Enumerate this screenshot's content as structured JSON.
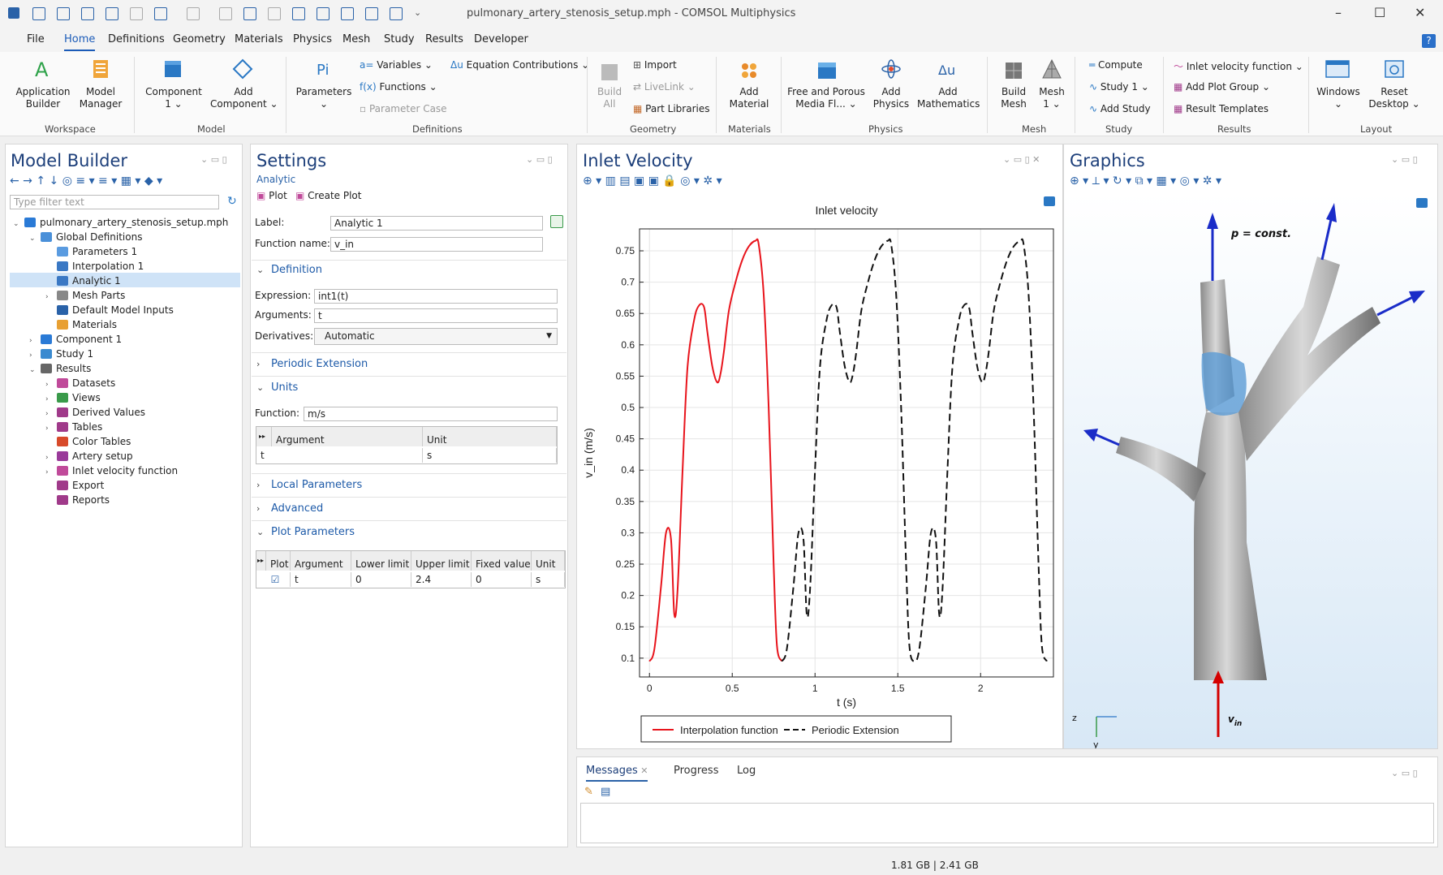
{
  "window": {
    "title": "pulmonary_artery_stenosis_setup.mph - COMSOL Multiphysics",
    "minimize": "–",
    "maximize": "☐",
    "close": "✕",
    "help": "?"
  },
  "menu": [
    "File",
    "Home",
    "Definitions",
    "Geometry",
    "Materials",
    "Physics",
    "Mesh",
    "Study",
    "Results",
    "Developer"
  ],
  "ribbon": {
    "application_builder": "Application\nBuilder",
    "model_manager": "Model\nManager",
    "component": "Component\n1 ⌄",
    "add_component": "Add\nComponent ⌄",
    "parameters": "Parameters\n⌄",
    "variables": "Variables ⌄",
    "functions": "Functions ⌄",
    "parameter_case": "Parameter Case",
    "equation_contributions": "Equation Contributions ⌄",
    "build_all": "Build\nAll",
    "import": "Import",
    "livelink": "LiveLink ⌄",
    "part_libraries": "Part Libraries",
    "add_material": "Add\nMaterial",
    "free_porous": "Free and Porous\nMedia Fl... ⌄",
    "add_physics": "Add\nPhysics",
    "add_mathematics": "Add\nMathematics",
    "build_mesh": "Build\nMesh",
    "mesh1": "Mesh\n1 ⌄",
    "compute": "Compute",
    "study1": "Study 1 ⌄",
    "add_study": "Add Study",
    "inlet_velocity_function": "Inlet velocity function ⌄",
    "add_plot_group": "Add Plot Group ⌄",
    "result_templates": "Result Templates",
    "windows": "Windows\n⌄",
    "reset_desktop": "Reset\nDesktop ⌄",
    "groups": [
      "Workspace",
      "Model",
      "Definitions",
      "Geometry",
      "Materials",
      "Physics",
      "Mesh",
      "Study",
      "Results",
      "Layout"
    ]
  },
  "model_builder": {
    "title": "Model Builder",
    "filter_placeholder": "Type filter text",
    "tree": [
      {
        "label": "pulmonary_artery_stenosis_setup.mph",
        "depth": 0,
        "arrow": "⌄",
        "color": "#2a7ad6"
      },
      {
        "label": "Global Definitions",
        "depth": 1,
        "arrow": "⌄",
        "color": "#4a90d9"
      },
      {
        "label": "Parameters 1",
        "depth": 2,
        "arrow": "",
        "color": "#5a9be0"
      },
      {
        "label": "Interpolation 1",
        "depth": 2,
        "arrow": "",
        "color": "#3a78c4"
      },
      {
        "label": "Analytic 1",
        "depth": 2,
        "arrow": "",
        "color": "#3a78c4"
      },
      {
        "label": "Mesh Parts",
        "depth": 2,
        "arrow": "›",
        "color": "#888"
      },
      {
        "label": "Default Model Inputs",
        "depth": 2,
        "arrow": "",
        "color": "#2a62a8"
      },
      {
        "label": "Materials",
        "depth": 2,
        "arrow": "",
        "color": "#e8a033"
      },
      {
        "label": "Component 1",
        "depth": 1,
        "arrow": "›",
        "color": "#2a7ad6"
      },
      {
        "label": "Study 1",
        "depth": 1,
        "arrow": "›",
        "color": "#3a8ad0"
      },
      {
        "label": "Results",
        "depth": 1,
        "arrow": "⌄",
        "color": "#666"
      },
      {
        "label": "Datasets",
        "depth": 2,
        "arrow": "›",
        "color": "#c04a9a"
      },
      {
        "label": "Views",
        "depth": 2,
        "arrow": "›",
        "color": "#3a9a4a"
      },
      {
        "label": "Derived Values",
        "depth": 2,
        "arrow": "›",
        "color": "#a03a8a"
      },
      {
        "label": "Tables",
        "depth": 2,
        "arrow": "›",
        "color": "#a03a8a"
      },
      {
        "label": "Color Tables",
        "depth": 2,
        "arrow": "",
        "color": "#d84a2a"
      },
      {
        "label": "Artery setup",
        "depth": 2,
        "arrow": "›",
        "color": "#9a3a9a"
      },
      {
        "label": "Inlet velocity function",
        "depth": 2,
        "arrow": "›",
        "color": "#c04a9a"
      },
      {
        "label": "Export",
        "depth": 2,
        "arrow": "",
        "color": "#a03a8a"
      },
      {
        "label": "Reports",
        "depth": 2,
        "arrow": "",
        "color": "#a03a8a"
      }
    ]
  },
  "settings": {
    "title": "Settings",
    "subtitle": "Analytic",
    "plot": "Plot",
    "create_plot": "Create Plot",
    "label_caption": "Label:",
    "label_value": "Analytic 1",
    "function_name_caption": "Function name:",
    "function_name_value": "v_in",
    "definition": "Definition",
    "expression_caption": "Expression:",
    "expression_value": "int1(t)",
    "arguments_caption": "Arguments:",
    "arguments_value": "t",
    "derivatives_caption": "Derivatives:",
    "derivatives_value": "Automatic",
    "periodic_extension": "Periodic Extension",
    "units": "Units",
    "function_caption": "Function:",
    "function_unit": "m/s",
    "units_table": {
      "headers": [
        "Argument",
        "Unit"
      ],
      "row": [
        "t",
        "s"
      ]
    },
    "local_parameters": "Local Parameters",
    "advanced": "Advanced",
    "plot_parameters": "Plot Parameters",
    "plot_table": {
      "headers": [
        "Plot",
        "Argument",
        "Lower limit",
        "Upper limit",
        "Fixed value",
        "Unit"
      ],
      "row": [
        "",
        "t",
        "0",
        "2.4",
        "0",
        "s"
      ]
    }
  },
  "inlet_velocity": {
    "title": "Inlet Velocity"
  },
  "chart_data": {
    "type": "line",
    "title": "Inlet velocity",
    "xlabel": "t (s)",
    "ylabel": "v_in (m/s)",
    "xlim": [
      -0.06,
      2.44
    ],
    "ylim": [
      0.07,
      0.785
    ],
    "xticks": [
      "0",
      "0.5",
      "1",
      "1.5",
      "2"
    ],
    "xtick_values": [
      0,
      0.5,
      1,
      1.5,
      2
    ],
    "yticks": [
      "0.1",
      "0.15",
      "0.2",
      "0.25",
      "0.3",
      "0.35",
      "0.4",
      "0.45",
      "0.5",
      "0.55",
      "0.6",
      "0.65",
      "0.7",
      "0.75"
    ],
    "ytick_values": [
      0.1,
      0.15,
      0.2,
      0.25,
      0.3,
      0.35,
      0.4,
      0.45,
      0.5,
      0.55,
      0.6,
      0.65,
      0.7,
      0.75
    ],
    "grid": true,
    "legend_position": "bottom",
    "series": [
      {
        "name": "Interpolation function",
        "color": "#e8141c",
        "dash": false,
        "x": [
          0,
          0.03,
          0.07,
          0.1,
          0.13,
          0.15,
          0.17,
          0.2,
          0.23,
          0.27,
          0.3,
          0.33,
          0.35,
          0.38,
          0.41,
          0.43,
          0.45,
          0.48,
          0.52,
          0.56,
          0.6,
          0.64,
          0.66,
          0.69,
          0.72,
          0.75,
          0.77,
          0.8
        ],
        "y": [
          0.095,
          0.115,
          0.215,
          0.3,
          0.29,
          0.17,
          0.21,
          0.4,
          0.565,
          0.64,
          0.663,
          0.66,
          0.62,
          0.565,
          0.54,
          0.555,
          0.59,
          0.655,
          0.7,
          0.735,
          0.757,
          0.766,
          0.76,
          0.68,
          0.5,
          0.25,
          0.12,
          0.095
        ]
      },
      {
        "name": "Periodic Extension",
        "color": "#111111",
        "dash": true,
        "x": [
          0.8,
          0.83,
          0.87,
          0.9,
          0.93,
          0.95,
          0.97,
          1.0,
          1.03,
          1.07,
          1.1,
          1.13,
          1.15,
          1.18,
          1.21,
          1.23,
          1.25,
          1.28,
          1.32,
          1.36,
          1.4,
          1.44,
          1.46,
          1.49,
          1.52,
          1.55,
          1.57,
          1.6,
          1.63,
          1.67,
          1.7,
          1.73,
          1.75,
          1.77,
          1.8,
          1.83,
          1.87,
          1.9,
          1.93,
          1.95,
          1.98,
          2.01,
          2.03,
          2.05,
          2.08,
          2.12,
          2.16,
          2.2,
          2.24,
          2.26,
          2.29,
          2.32,
          2.35,
          2.37,
          2.4
        ],
        "y": [
          0.095,
          0.115,
          0.215,
          0.3,
          0.29,
          0.17,
          0.21,
          0.4,
          0.565,
          0.64,
          0.663,
          0.66,
          0.62,
          0.565,
          0.54,
          0.555,
          0.59,
          0.655,
          0.7,
          0.735,
          0.757,
          0.766,
          0.76,
          0.68,
          0.5,
          0.25,
          0.12,
          0.095,
          0.115,
          0.215,
          0.3,
          0.29,
          0.17,
          0.21,
          0.4,
          0.565,
          0.64,
          0.663,
          0.66,
          0.62,
          0.565,
          0.54,
          0.555,
          0.59,
          0.655,
          0.7,
          0.735,
          0.757,
          0.766,
          0.76,
          0.68,
          0.5,
          0.25,
          0.12,
          0.095
        ]
      }
    ]
  },
  "graphics": {
    "title": "Graphics",
    "p_label": "p = const.",
    "vin_label": "v",
    "vin_sub": "in",
    "axis_z": "z",
    "axis_y": "y"
  },
  "messages": {
    "tabs": [
      "Messages",
      "Progress",
      "Log"
    ]
  },
  "status": {
    "memory": "1.81 GB | 2.41 GB"
  }
}
